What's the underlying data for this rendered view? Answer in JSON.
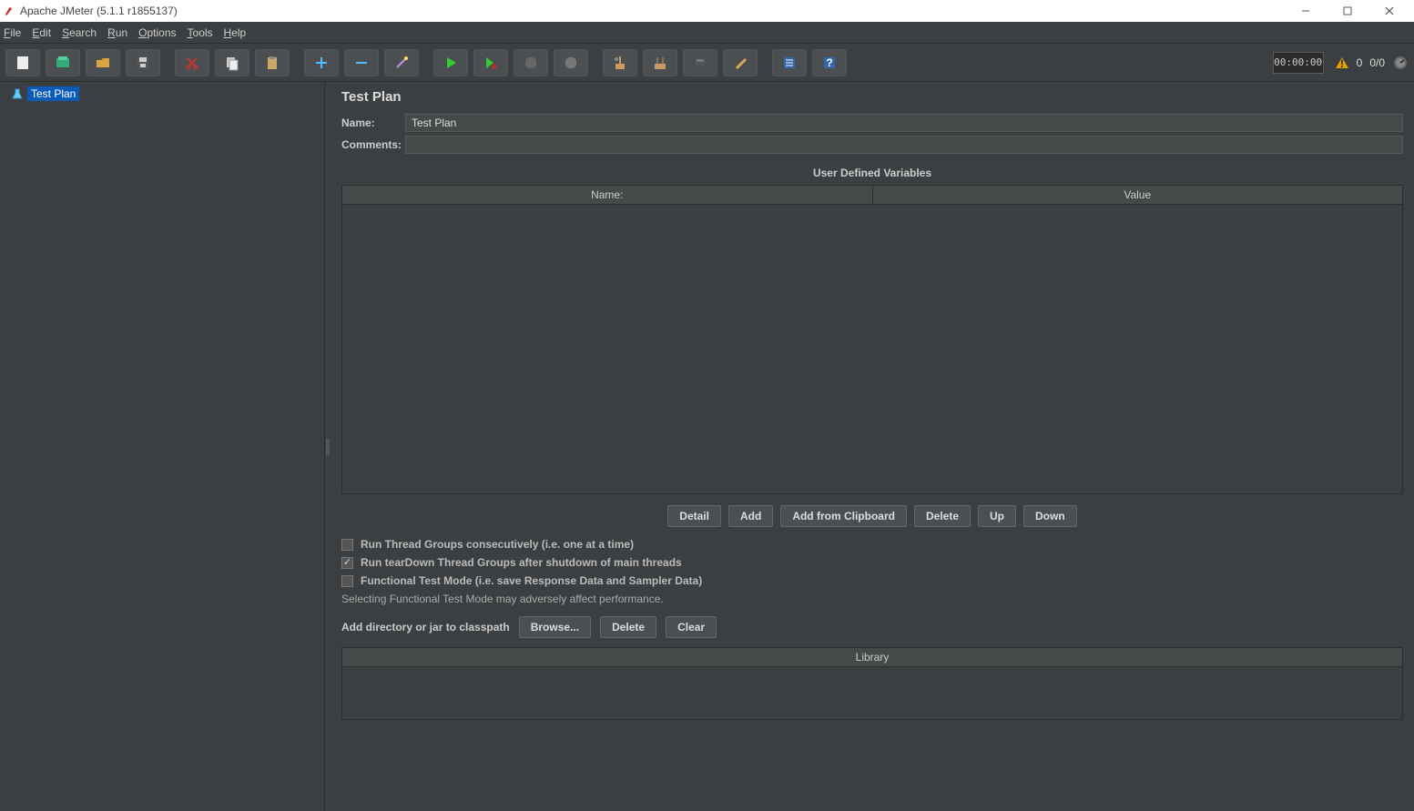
{
  "title": "Apache JMeter (5.1.1 r1855137)",
  "menu": {
    "file": "File",
    "edit": "Edit",
    "search": "Search",
    "run": "Run",
    "options": "Options",
    "tools": "Tools",
    "help": "Help"
  },
  "toolbar": {
    "timer": "00:00:00",
    "errors": "0",
    "threads": "0/0"
  },
  "tree": {
    "root": "Test Plan"
  },
  "panel": {
    "heading": "Test Plan",
    "name_label": "Name:",
    "name_value": "Test Plan",
    "comments_label": "Comments:",
    "comments_value": "",
    "vars_title": "User Defined Variables",
    "col_name": "Name:",
    "col_value": "Value",
    "btn_detail": "Detail",
    "btn_add": "Add",
    "btn_add_clip": "Add from Clipboard",
    "btn_delete": "Delete",
    "btn_up": "Up",
    "btn_down": "Down",
    "cb_consec": "Run Thread Groups consecutively (i.e. one at a time)",
    "cb_teardown": "Run tearDown Thread Groups after shutdown of main threads",
    "cb_func": "Functional Test Mode (i.e. save Response Data and Sampler Data)",
    "note": "Selecting Functional Test Mode may adversely affect performance.",
    "cp_label": "Add directory or jar to classpath",
    "btn_browse": "Browse...",
    "btn_cp_delete": "Delete",
    "btn_clear": "Clear",
    "lib_header": "Library"
  }
}
